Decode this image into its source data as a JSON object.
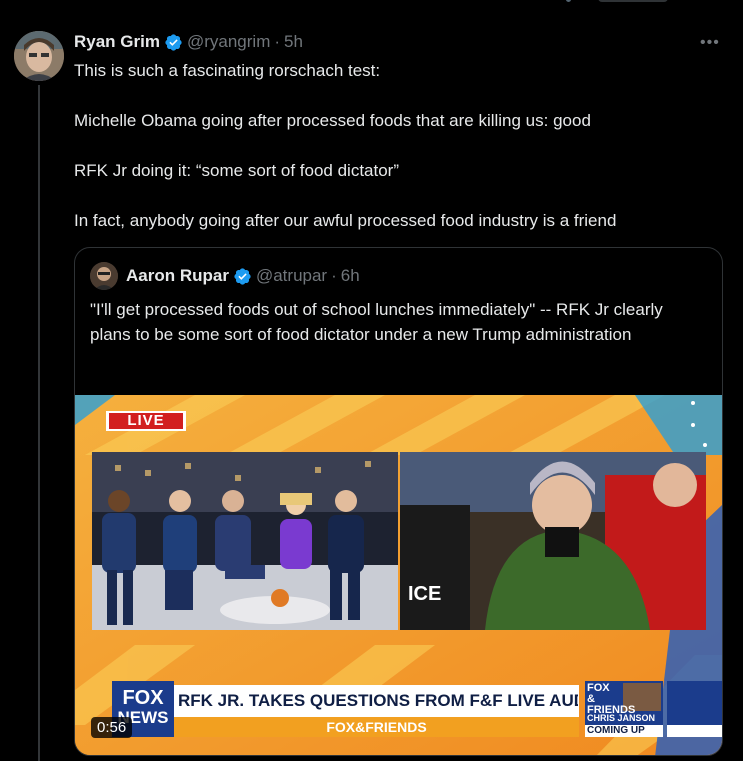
{
  "tweet": {
    "author_name": "Ryan Grim",
    "handle": "@ryangrim",
    "separator": "·",
    "time": "5h",
    "more_label": "•••",
    "lines": [
      "This is such a fascinating rorschach test:",
      "Michelle Obama going after processed foods that are killing us: good",
      "RFK Jr doing it: “some sort of food dictator”",
      "In fact, anybody going after our awful processed food industry is a friend"
    ]
  },
  "quote": {
    "author_name": "Aaron Rupar",
    "handle": "@atrupar",
    "separator": "·",
    "time": "6h",
    "text": "\"I'll get processed foods out of school lunches immediately\" -- RFK Jr clearly plans to be some sort of food dictator under a new Trump administration"
  },
  "video": {
    "live_label": "LIVE",
    "chyron": "RFK JR. TAKES QUESTIONS FROM F&F LIVE AUDIENCE",
    "show_name": "FOX&FRIENDS",
    "logo_top": "FOX",
    "logo_bottom": "NEWS",
    "side_top": "FOX",
    "side_mid": "&",
    "side_low": "FRIENDS",
    "side_name": "CHRIS JANSON",
    "side_coming": "COMING UP",
    "duration": "0:56"
  },
  "colors": {
    "background": "#000000",
    "text": "#e7e9ea",
    "muted": "#71767b",
    "verified": "#1d9bf0",
    "border": "#2f3336"
  }
}
